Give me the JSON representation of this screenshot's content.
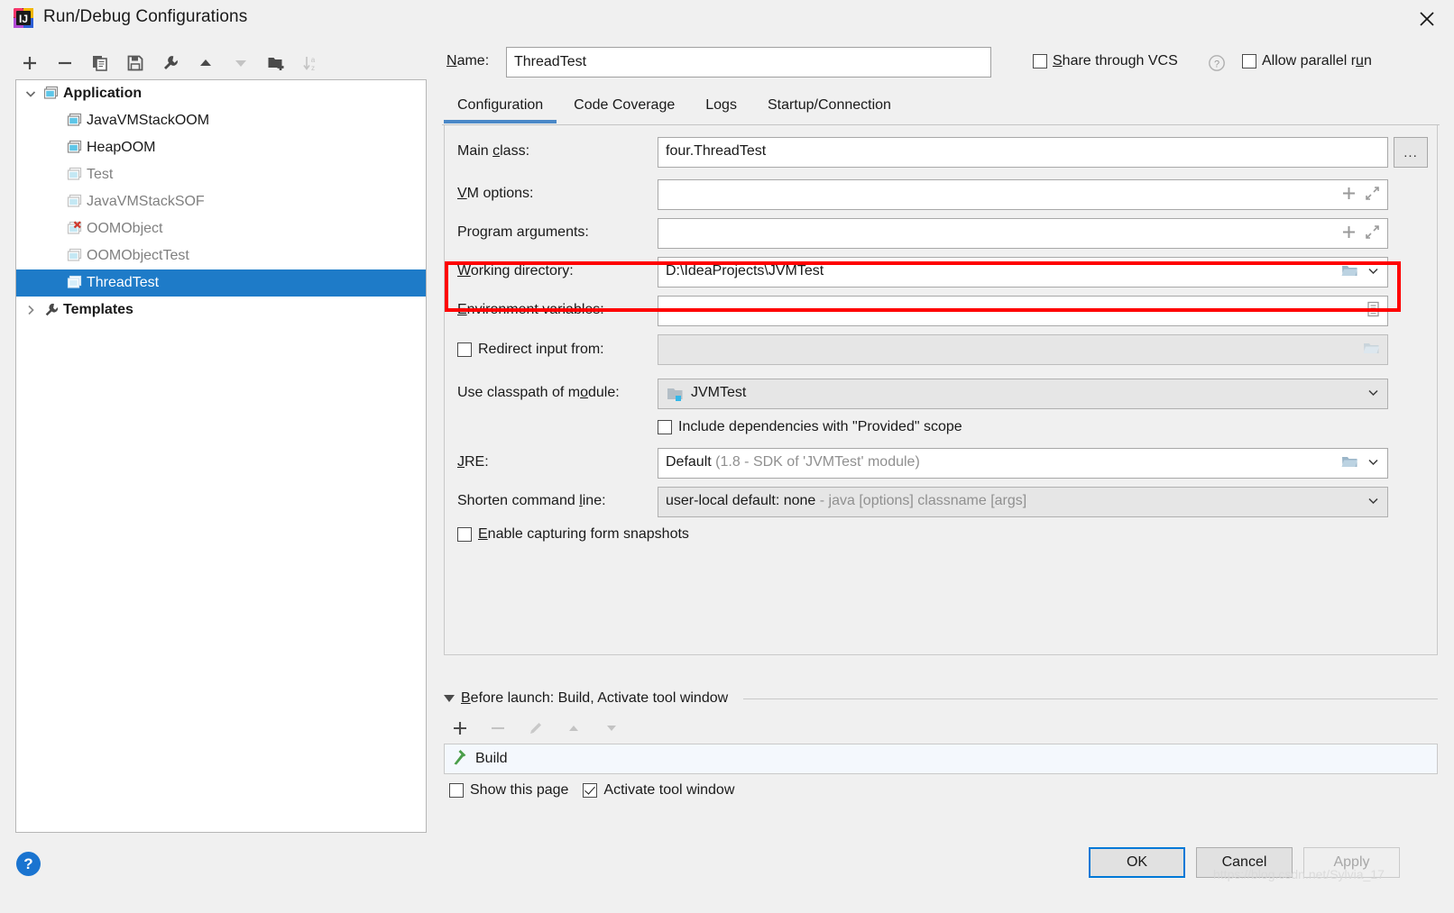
{
  "window": {
    "title": "Run/Debug Configurations",
    "app_icon": "intellij-idea-icon",
    "close_label": "×"
  },
  "toolbar": {
    "buttons": [
      {
        "name": "add-configuration-button",
        "icon": "plus-icon",
        "label": "+",
        "enabled": true
      },
      {
        "name": "remove-configuration-button",
        "icon": "minus-icon",
        "label": "−",
        "enabled": true
      },
      {
        "name": "copy-configuration-button",
        "icon": "copy-icon",
        "label": "",
        "enabled": true
      },
      {
        "name": "save-configuration-button",
        "icon": "save-icon",
        "label": "",
        "enabled": true
      },
      {
        "name": "edit-templates-button",
        "icon": "wrench-icon",
        "label": "",
        "enabled": true
      },
      {
        "name": "move-up-button",
        "icon": "arrow-up-icon",
        "label": "",
        "enabled": true
      },
      {
        "name": "move-down-button",
        "icon": "arrow-down-icon",
        "label": "",
        "enabled": false
      },
      {
        "name": "new-folder-button",
        "icon": "folder-add-icon",
        "label": "",
        "enabled": true
      },
      {
        "name": "sort-alphabetically-button",
        "icon": "sort-az-icon",
        "label": "",
        "enabled": false
      }
    ]
  },
  "tree": {
    "items": [
      {
        "label": "Application",
        "icon": "application-icon",
        "bold": true,
        "dim": false,
        "expanded": true,
        "twisty": "chevron-down",
        "level": 0,
        "selected": false,
        "error": false
      },
      {
        "label": "JavaVMStackOOM",
        "icon": "application-icon",
        "bold": false,
        "dim": false,
        "expanded": null,
        "twisty": "none",
        "level": 1,
        "selected": false,
        "error": false
      },
      {
        "label": "HeapOOM",
        "icon": "application-icon",
        "bold": false,
        "dim": false,
        "expanded": null,
        "twisty": "none",
        "level": 1,
        "selected": false,
        "error": false
      },
      {
        "label": "Test",
        "icon": "application-icon",
        "bold": false,
        "dim": true,
        "expanded": null,
        "twisty": "none",
        "level": 1,
        "selected": false,
        "error": false
      },
      {
        "label": "JavaVMStackSOF",
        "icon": "application-icon",
        "bold": false,
        "dim": true,
        "expanded": null,
        "twisty": "none",
        "level": 1,
        "selected": false,
        "error": false
      },
      {
        "label": "OOMObject",
        "icon": "application-icon",
        "bold": false,
        "dim": true,
        "expanded": null,
        "twisty": "none",
        "level": 1,
        "selected": false,
        "error": true
      },
      {
        "label": "OOMObjectTest",
        "icon": "application-icon",
        "bold": false,
        "dim": true,
        "expanded": null,
        "twisty": "none",
        "level": 1,
        "selected": false,
        "error": false
      },
      {
        "label": "ThreadTest",
        "icon": "application-icon",
        "bold": false,
        "dim": false,
        "expanded": null,
        "twisty": "none",
        "level": 1,
        "selected": true,
        "error": false
      },
      {
        "label": "Templates",
        "icon": "wrench-icon",
        "bold": true,
        "dim": false,
        "expanded": false,
        "twisty": "chevron-right",
        "level": 0,
        "selected": false,
        "error": false
      }
    ]
  },
  "form": {
    "name_label": "Name:",
    "name_value": "ThreadTest",
    "share_through_vcs": {
      "label": "Share through VCS",
      "checked": false,
      "help_icon": "question-circle-icon"
    },
    "allow_parallel_run": {
      "label": "Allow parallel run",
      "checked": false
    }
  },
  "tabs": [
    {
      "label": "Configuration",
      "active": true
    },
    {
      "label": "Code Coverage",
      "active": false
    },
    {
      "label": "Logs",
      "active": false
    },
    {
      "label": "Startup/Connection",
      "active": false
    }
  ],
  "config": {
    "main_class": {
      "label": "Main class:",
      "value": "four.ThreadTest",
      "browse_label": "..."
    },
    "vm_options": {
      "label": "VM options:",
      "value": "",
      "adorn": [
        "plus-icon",
        "expand-icon"
      ],
      "highlighted": true
    },
    "program_arguments": {
      "label": "Program arguments:",
      "value": "",
      "adorn": [
        "plus-icon",
        "expand-icon"
      ]
    },
    "working_directory": {
      "label": "Working directory:",
      "value": "D:\\IdeaProjects\\JVMTest",
      "adorn": [
        "folder-icon",
        "chevron-down-icon"
      ]
    },
    "environment_variables": {
      "label": "Environment variables:",
      "value": "",
      "adorn": [
        "list-icon"
      ]
    },
    "redirect_input": {
      "label": "Redirect input from:",
      "checked": false,
      "value": "",
      "adorn": [
        "folder-icon"
      ],
      "disabled": true
    },
    "classpath_module": {
      "label": "Use classpath of module:",
      "value": "JVMTest",
      "icon": "module-folder-icon",
      "adorn": [
        "chevron-down-icon"
      ]
    },
    "include_provided": {
      "label": "Include dependencies with \"Provided\" scope",
      "checked": false
    },
    "jre": {
      "label": "JRE:",
      "value": "Default",
      "value_muted": "(1.8 - SDK of 'JVMTest' module)",
      "adorn": [
        "folder-icon",
        "chevron-down-icon"
      ]
    },
    "shorten_command_line": {
      "label": "Shorten command line:",
      "value": "user-local default: none",
      "value_muted": "- java [options] classname [args]",
      "adorn": [
        "chevron-down-icon"
      ]
    },
    "form_snapshots": {
      "label": "Enable capturing form snapshots",
      "checked": false
    }
  },
  "before_launch": {
    "header": "Before launch: Build, Activate tool window",
    "expanded": true,
    "toolbar": [
      {
        "name": "add-task-button",
        "icon": "plus-icon",
        "enabled": true
      },
      {
        "name": "remove-task-button",
        "icon": "minus-icon",
        "enabled": false
      },
      {
        "name": "edit-task-button",
        "icon": "pencil-icon",
        "enabled": false
      },
      {
        "name": "move-task-up-button",
        "icon": "arrow-up-icon",
        "enabled": false
      },
      {
        "name": "move-task-down-button",
        "icon": "arrow-down-icon",
        "enabled": false
      }
    ],
    "tasks": [
      {
        "label": "Build",
        "icon": "build-hammer-icon"
      }
    ],
    "show_this_page": {
      "label": "Show this page",
      "checked": false
    },
    "activate_tool_window": {
      "label": "Activate tool window",
      "checked": true
    }
  },
  "footer": {
    "help_label": "?",
    "ok_label": "OK",
    "cancel_label": "Cancel",
    "apply_label": "Apply",
    "apply_enabled": false,
    "watermark": "https://blog.csdn.net/Sylvia_17"
  },
  "colors": {
    "accent_blue": "#1e7bc8",
    "tab_underline": "#4a88c7",
    "highlight_red": "#ff0000",
    "help_blue": "#1a74d0",
    "build_green": "#4a9e4a",
    "error_red": "#d0382c"
  }
}
